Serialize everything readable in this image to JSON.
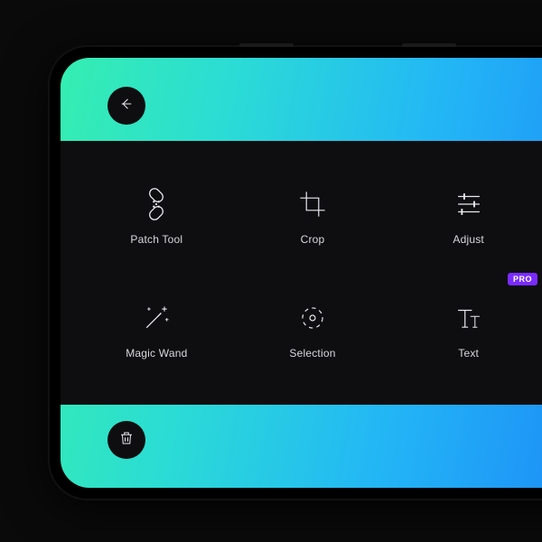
{
  "pro_badge": "PRO",
  "tools": [
    {
      "label": "Patch Tool"
    },
    {
      "label": "Crop"
    },
    {
      "label": "Adjust"
    },
    {
      "label": "Magic Wand"
    },
    {
      "label": "Selection"
    },
    {
      "label": "Text"
    }
  ]
}
